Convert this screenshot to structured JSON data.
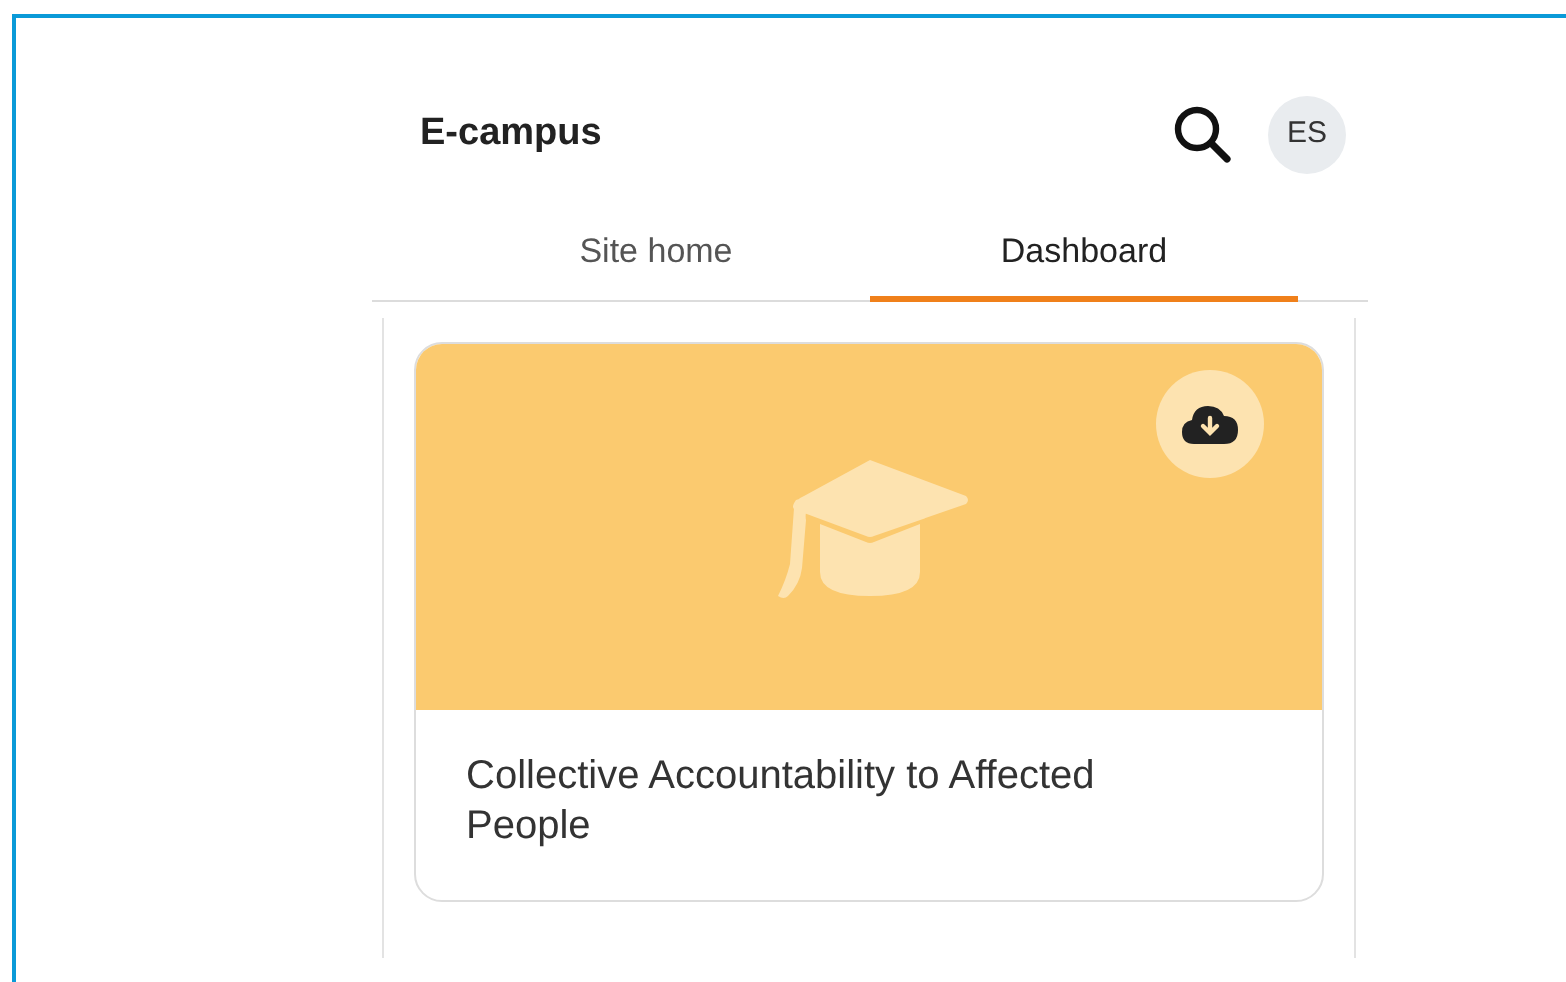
{
  "header": {
    "title": "E-campus",
    "avatar_initials": "ES"
  },
  "tabs": [
    {
      "label": "Site home",
      "selected": false
    },
    {
      "label": "Dashboard",
      "selected": true
    }
  ],
  "courses": [
    {
      "title": "Collective Accountability to Affected People",
      "image": {
        "kind": "placeholder"
      }
    }
  ]
}
